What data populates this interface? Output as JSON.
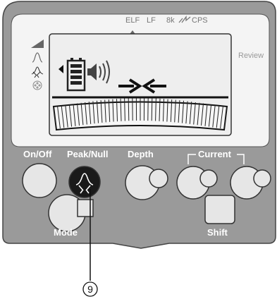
{
  "modes": {
    "elf": "ELF",
    "lf": "LF",
    "khz": "8k",
    "cps": "CPS"
  },
  "review_label": "Review",
  "buttons": {
    "onoff": "On/Off",
    "peaknull": "Peak/Null",
    "depth": "Depth",
    "current": "Current",
    "mode": "Mode",
    "shift": "Shift"
  },
  "callout": "9",
  "colors": {
    "panel": "#9a9a9a",
    "panel_dark": "#6f6f6f",
    "screen": "#eeeeee",
    "button": "#e6e6e6",
    "active_button": "#1a1a1a",
    "text_on_panel": "#ffffff"
  },
  "icons": [
    "signal-strength-icon",
    "peak-icon",
    "null-icon",
    "sonde-icon",
    "battery-icon",
    "speaker-icon",
    "arrow-right-icon",
    "arrow-left-icon",
    "bargraph-icon"
  ]
}
